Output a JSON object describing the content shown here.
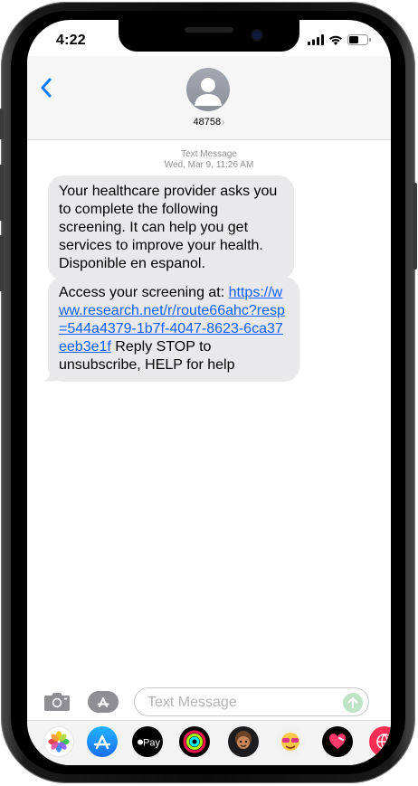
{
  "status_bar": {
    "time": "4:22"
  },
  "header": {
    "contact_number": "48758",
    "contact_chevron": "›"
  },
  "conversation": {
    "timestamp_label": "Text Message",
    "timestamp_date": "Wed, Mar 9, 11:26 AM",
    "messages": [
      {
        "text": "Your healthcare provider asks you to complete the following screening. It can help you get services to improve your health. Disponible en espanol."
      },
      {
        "prefix": "Access your screening at: ",
        "link": "https://www.research.net/r/route66ahc?resp=544a4379-1b7f-4047-8623-6ca37eeb3e1f",
        "suffix": " Reply STOP to unsubscribe, HELP for help"
      }
    ]
  },
  "compose": {
    "placeholder": "Text Message"
  },
  "app_drawer": {
    "apple_pay_label": "Pay",
    "apps": [
      "photos-app",
      "app-store-app",
      "apple-pay-app",
      "activity-app",
      "memoji-app",
      "animoji-app",
      "digital-touch-app",
      "web-search-app"
    ]
  },
  "colors": {
    "bubble": "#e9e9eb",
    "link": "#0a60ff",
    "accent": "#007aff",
    "send_disabled": "#bfe3c5"
  }
}
